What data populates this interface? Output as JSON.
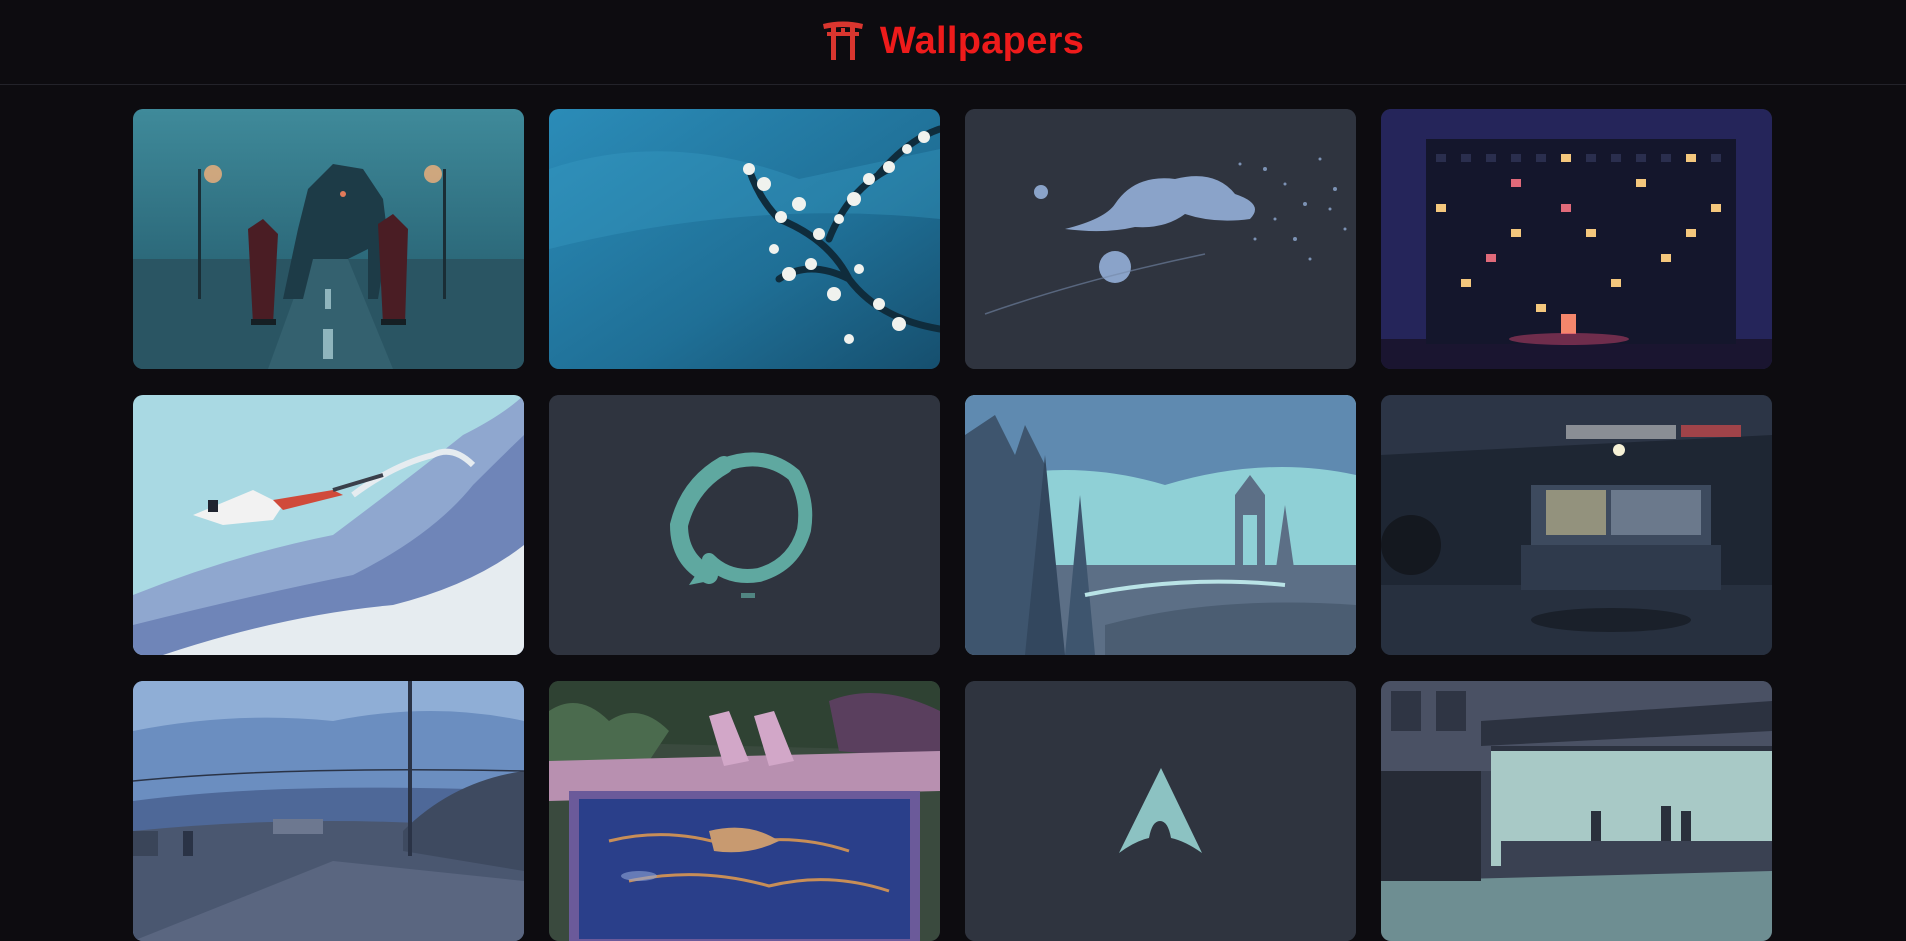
{
  "header": {
    "icon": "torii-gate-icon",
    "title": "Wallpapers",
    "accent_color": "#ee1b1b"
  },
  "wallpapers": [
    {
      "subject": "mech-robot-rainy-road"
    },
    {
      "subject": "cherry-blossom-branch"
    },
    {
      "subject": "minimal-bonsai-particles"
    },
    {
      "subject": "night-apartment-building"
    },
    {
      "subject": "diver-in-wave"
    },
    {
      "subject": "koi-enso-circle"
    },
    {
      "subject": "ruined-cathedral-forest"
    },
    {
      "subject": "workshop-garage"
    },
    {
      "subject": "suburban-street-dusk"
    },
    {
      "subject": "pool-lounge-chairs"
    },
    {
      "subject": "arch-linux-logo"
    },
    {
      "subject": "nighthawks-diner"
    }
  ]
}
